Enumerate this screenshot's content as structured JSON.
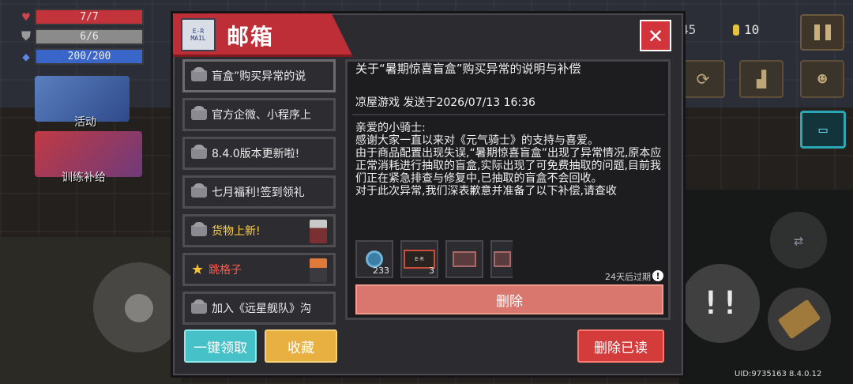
{
  "hud": {
    "hp": "7/7",
    "armor": "6/6",
    "energy": "200/200",
    "colors": {
      "hp": "#c2333b",
      "armor": "#8b8b8b",
      "energy": "#3b66c9"
    }
  },
  "side": {
    "activity_label": "活动",
    "training_label": "训练补给"
  },
  "top_right": {
    "left_count": "45",
    "gem_count": "10"
  },
  "mail": {
    "title": "邮箱",
    "mail_icon_text_1": "E-R",
    "mail_icon_text_2": "MAIL",
    "close_glyph": "✕",
    "items": [
      {
        "label": "盲盒”购买异常的说"
      },
      {
        "label": "官方企微、小程序上"
      },
      {
        "label": "8.4.0版本更新啦!"
      },
      {
        "label": "七月福利!签到领礼"
      },
      {
        "label": "货物上新!"
      },
      {
        "label": "跳格子"
      },
      {
        "label": "加入《远星舰队》沟"
      }
    ],
    "detail": {
      "subject": "关于“暑期惊喜盲盒”购买异常的说明与补偿",
      "sender_line": "凉屋游戏 发送于2026/07/13 16:36",
      "body": [
        "亲爱的小骑士:",
        " 感谢大家一直以来对《元气骑士》的支持与喜爱。",
        "由于商品配置出现失误,“暑期惊喜盲盒”出现了异常情况,原本应正常消耗进行抽取的盲盒,实际出现了可免费抽取的问题,目前我们正在紧急排查与修复中,已抽取的盲盒不会回收。",
        "对于此次异常,我们深表歉意并准备了以下补偿,请查收"
      ],
      "attachments": [
        {
          "icon": "gem-coin-icon",
          "count": "233"
        },
        {
          "icon": "ticket-icon",
          "count": "3",
          "text": "E-R"
        },
        {
          "icon": "pink-ticket-icon",
          "count": ""
        },
        {
          "icon": "pink-ticket-icon",
          "count": ""
        }
      ],
      "expire_text": "24天后过期",
      "delete_label": "删除"
    },
    "claim_all_label": "一键领取",
    "favorite_label": "收藏",
    "delete_read_label": "删除已读"
  },
  "uid_text": "UID:9735163 8.4.0.12",
  "colors": {
    "title_red": "#bd2e36",
    "claim_teal": "#46c1c8",
    "favorite_gold": "#e8b040",
    "delete_salmon": "#d9776e",
    "delete_read_red": "#d43c3c"
  }
}
